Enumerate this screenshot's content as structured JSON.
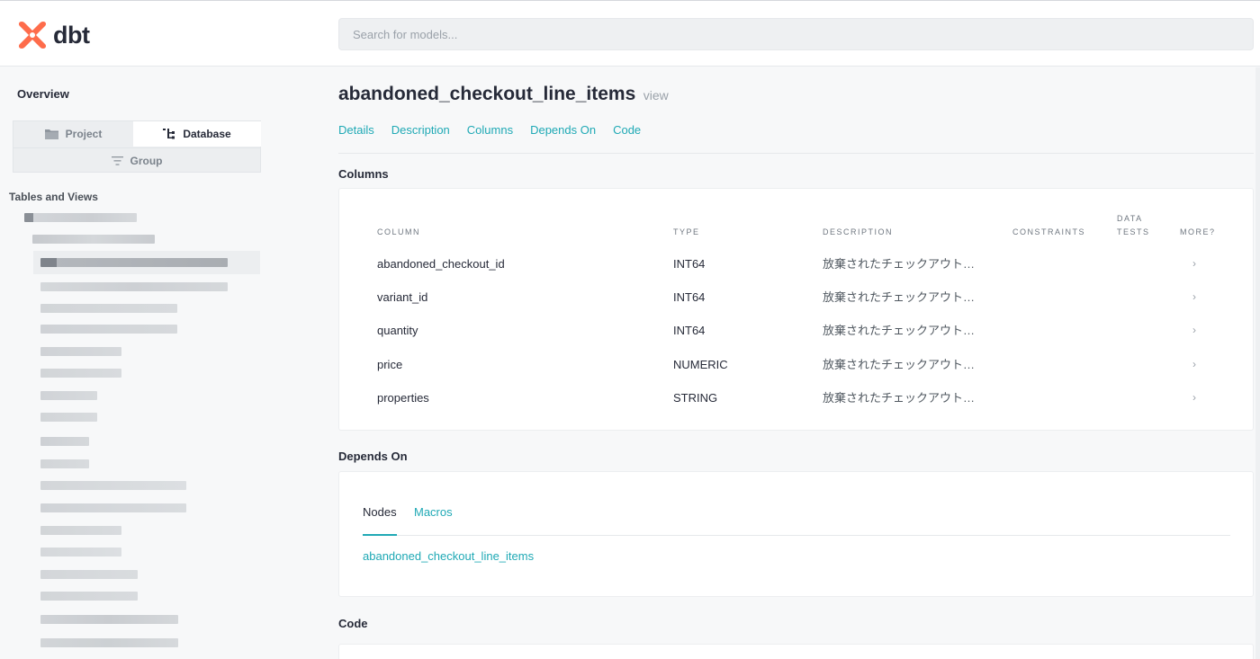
{
  "app": {
    "logo_text": "dbt",
    "brand_color": "#fe6c4b",
    "accent_color": "#1fa9b5"
  },
  "search": {
    "placeholder": "Search for models..."
  },
  "sidebar": {
    "overview_label": "Overview",
    "switcher": {
      "project_label": "Project",
      "database_label": "Database",
      "group_label": "Group",
      "project_icon": "folder-icon",
      "database_icon": "tree-icon",
      "group_icon": "filter-icon"
    },
    "tables_heading": "Tables and Views"
  },
  "model": {
    "name": "abandoned_checkout_line_items",
    "type": "view"
  },
  "nav_tabs": [
    {
      "label": "Details"
    },
    {
      "label": "Description"
    },
    {
      "label": "Columns"
    },
    {
      "label": "Depends On"
    },
    {
      "label": "Code"
    }
  ],
  "columns_section": {
    "heading": "Columns",
    "headers": {
      "column": "COLUMN",
      "type": "TYPE",
      "description": "DESCRIPTION",
      "constraints": "CONSTRAINTS",
      "data_tests_1": "DATA",
      "data_tests_2": "TESTS",
      "more": "MORE?"
    },
    "rows": [
      {
        "name": "abandoned_checkout_id",
        "type": "INT64",
        "description": "放棄されたチェックアウトの..."
      },
      {
        "name": "variant_id",
        "type": "INT64",
        "description": "放棄されたチェックアウト明..."
      },
      {
        "name": "quantity",
        "type": "INT64",
        "description": "放棄されたチェックアウトの..."
      },
      {
        "name": "price",
        "type": "NUMERIC",
        "description": "放棄されたチェックアウト明..."
      },
      {
        "name": "properties",
        "type": "STRING",
        "description": "放棄されたチェックアウト明..."
      }
    ]
  },
  "depends_section": {
    "heading": "Depends On",
    "tabs": {
      "nodes": "Nodes",
      "macros": "Macros"
    },
    "link": "abandoned_checkout_line_items"
  },
  "code_section": {
    "heading": "Code"
  }
}
